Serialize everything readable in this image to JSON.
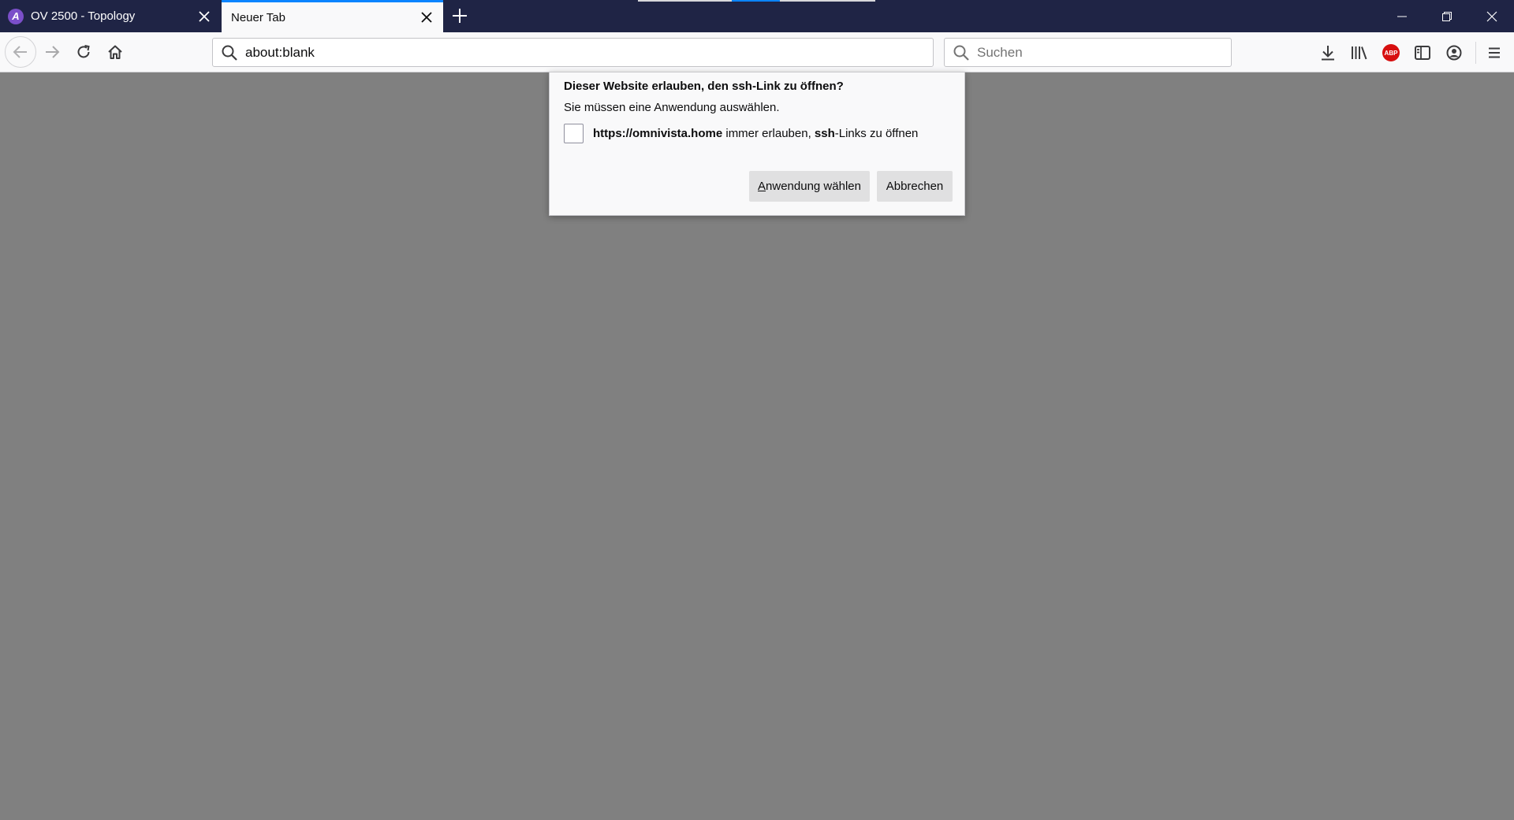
{
  "tabs": [
    {
      "label": "OV 2500 - Topology",
      "active": false,
      "favicon": "alcatel-logo-icon"
    },
    {
      "label": "Neuer Tab",
      "active": true
    }
  ],
  "toolbar": {
    "url": "about:blank",
    "search_placeholder": "Suchen",
    "abp_label": "ABP"
  },
  "dialog": {
    "title": "Dieser Website erlauben, den ssh-Link zu öffnen?",
    "subtitle": "Sie müssen eine Anwendung auswählen.",
    "checkbox": {
      "site": "https://omnivista.home",
      "mid": " immer erlauben, ",
      "protocol": "ssh",
      "end": "-Links zu öffnen",
      "checked": false
    },
    "choose_first_letter": "A",
    "choose_rest": "nwendung wählen",
    "cancel_label": "Abbrechen"
  },
  "colors": {
    "titlebar": "#1f2445",
    "toolbar": "#f9f9fa",
    "content": "#808080",
    "accent": "#0a84ff",
    "abp": "#d70f0f"
  }
}
